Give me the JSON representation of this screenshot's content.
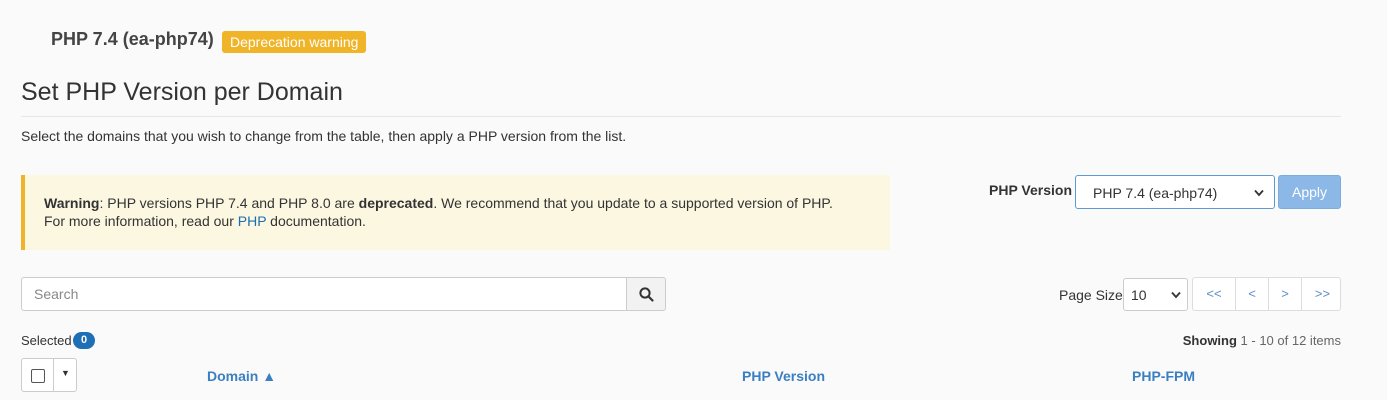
{
  "header": {
    "current_php": "PHP 7.4 (ea-php74)",
    "badge": "Deprecation warning",
    "badge_color": "#f0b429"
  },
  "title": "Set PHP Version per Domain",
  "intro": "Select the domains that you wish to change from the table, then apply a PHP version from the list.",
  "warning": {
    "label": "Warning",
    "text_before_bold": ": PHP versions PHP 7.4 and PHP 8.0 are ",
    "bold": "deprecated",
    "text_after_bold": ". We recommend that you update to a supported version of PHP.",
    "line2_before_link": "For more information, read our ",
    "link": "PHP",
    "line2_after_link": " documentation."
  },
  "version_selector": {
    "label": "PHP Version",
    "selected": "PHP 7.4 (ea-php74)",
    "apply_label": "Apply"
  },
  "search": {
    "placeholder": "Search",
    "icon": "search-icon"
  },
  "pagination": {
    "page_size_label": "Page Size",
    "page_size": "10",
    "first": "<<",
    "prev": "<",
    "next": ">",
    "last": ">>"
  },
  "selection": {
    "label": "Selected",
    "count": "0"
  },
  "showing": {
    "label": "Showing",
    "range": " 1 - 10 of 12 items"
  },
  "table": {
    "columns": [
      "Domain ▲",
      "PHP Version",
      "PHP-FPM"
    ]
  },
  "colors": {
    "accent_link": "#3a7fc1",
    "warning_bg": "#fcf7e1",
    "apply_bg": "#8bb8e6",
    "count_badge": "#1f6fb5"
  }
}
